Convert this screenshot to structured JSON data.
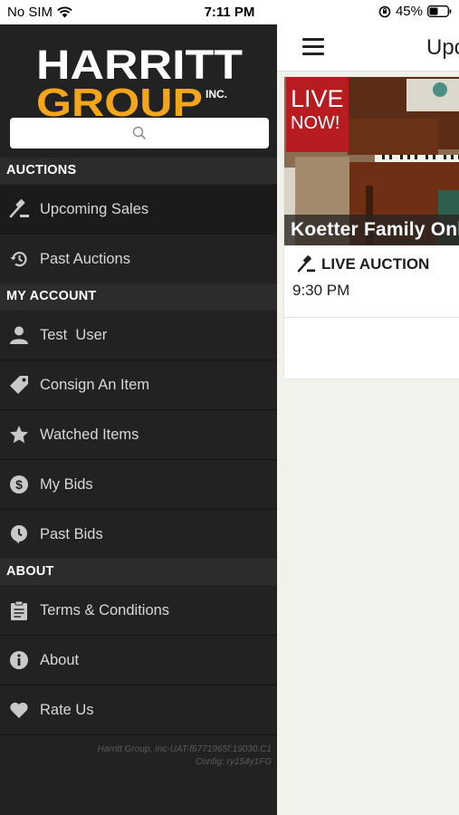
{
  "status_bar": {
    "carrier": "No SIM",
    "time": "7:11 PM",
    "battery": "45%"
  },
  "drawer": {
    "search_icon": "search-icon",
    "sections": {
      "auctions": "AUCTIONS",
      "my_account": "MY ACCOUNT",
      "about": "ABOUT"
    },
    "items": [
      {
        "label": "Upcoming Sales",
        "icon": "gavel-icon"
      },
      {
        "label": "Past Auctions",
        "icon": "history-icon"
      },
      {
        "label": "Test  User",
        "icon": "user-icon"
      },
      {
        "label": "Consign An Item",
        "icon": "tag-icon"
      },
      {
        "label": "Watched Items",
        "icon": "star-icon"
      },
      {
        "label": "My Bids",
        "icon": "dollar-icon"
      },
      {
        "label": "Past Bids",
        "icon": "past-bids-icon"
      },
      {
        "label": "Terms & Conditions",
        "icon": "clipboard-icon"
      },
      {
        "label": "About",
        "icon": "info-icon"
      },
      {
        "label": "Rate Us",
        "icon": "heart-icon"
      }
    ],
    "footer_line1": "Harritt Group, Inc-UAT-f6771965f:19030.C1",
    "footer_line2": "Config: ry154y1FG"
  },
  "main": {
    "title": "Upcoming Sales",
    "card": {
      "badge_line1": "LIVE",
      "badge_line2": "NOW!",
      "title": "Koetter Family Online Auction",
      "type": "LIVE AUCTION",
      "time": "9:30 PM"
    }
  },
  "colors": {
    "drawer_bg": "#222222",
    "badge_red": "#b61c20",
    "logo_orange": "#f3a51c"
  }
}
